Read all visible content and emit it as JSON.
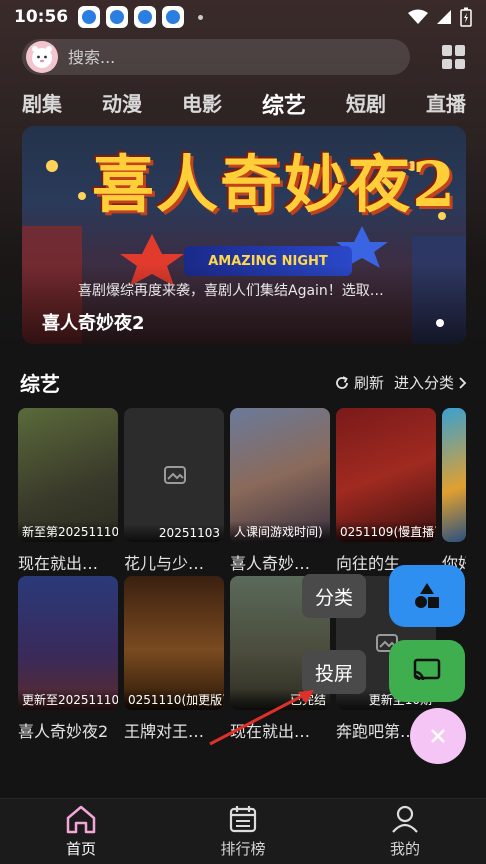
{
  "status_bar": {
    "time": "10:56"
  },
  "search": {
    "placeholder": "搜索..."
  },
  "tabs": [
    {
      "label": "剧集"
    },
    {
      "label": "动漫"
    },
    {
      "label": "电影"
    },
    {
      "label": "综艺",
      "active": true
    },
    {
      "label": "短剧"
    },
    {
      "label": "直播"
    }
  ],
  "banner": {
    "art_title": "喜人奇妙夜2",
    "art_subtitle": "AMAZING NIGHT",
    "description": "喜剧爆综再度来袭，喜剧人们集结Again！选取…",
    "name": "喜人奇妙夜2"
  },
  "section": {
    "title": "综艺",
    "refresh": "刷新",
    "more": "进入分类"
  },
  "row1": [
    {
      "badge": "新至第20251110",
      "title": "现在就出…",
      "badge_align": "left"
    },
    {
      "badge": "20251103",
      "title": "花儿与少…",
      "badge_align": "right"
    },
    {
      "badge": "人课间游戏时间)",
      "title": "喜人奇妙…",
      "badge_align": "left"
    },
    {
      "badge": "0251109(慢直播)",
      "title": "向往的生…",
      "badge_align": "left"
    },
    {
      "badge": "",
      "title": "你好",
      "badge_align": "left"
    }
  ],
  "row2": [
    {
      "badge": "更新至20251110",
      "title": "喜人奇妙夜2",
      "badge_align": "left"
    },
    {
      "badge": "0251110(加更版)",
      "title": "王牌对王…",
      "badge_align": "left"
    },
    {
      "badge": "已完结",
      "title": "现在就出…",
      "badge_align": "right"
    },
    {
      "badge": "更新至10期",
      "title": "奔跑吧第…",
      "badge_align": "right"
    }
  ],
  "floating_menu": {
    "category_label": "分类",
    "cast_label": "投屏",
    "category_color": "#2f8ff0",
    "cast_color": "#3fae4f",
    "close_color": "#f5c6f5"
  },
  "bottom_nav": [
    {
      "label": "首页",
      "active": true
    },
    {
      "label": "排行榜"
    },
    {
      "label": "我的"
    }
  ],
  "colors": {
    "accent_pink": "#f3a6d8",
    "background": "#141414"
  }
}
